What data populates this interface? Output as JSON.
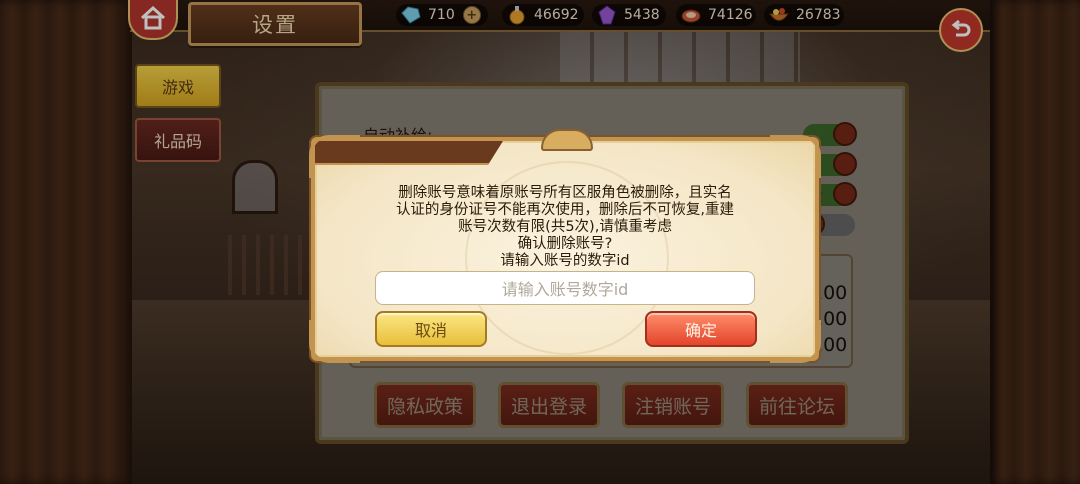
{
  "header": {
    "title": "设置",
    "resources": [
      {
        "icon": "crystal-icon",
        "value": "710",
        "has_plus": true
      },
      {
        "icon": "potion-icon",
        "value": "46692",
        "has_plus": false
      },
      {
        "icon": "gem-icon",
        "value": "5438",
        "has_plus": false
      },
      {
        "icon": "meat-icon",
        "value": "74126",
        "has_plus": false
      },
      {
        "icon": "food-bowl-icon",
        "value": "26783",
        "has_plus": false
      }
    ]
  },
  "tabs": {
    "game": "游戏",
    "gift_code": "礼品码"
  },
  "panel": {
    "auto_supply_label": "自动补给:",
    "numbers": [
      "100",
      "100",
      "100"
    ],
    "partial_text": "文",
    "buttons": {
      "privacy": "隐私政策",
      "logout": "退出登录",
      "delete_account": "注销账号",
      "forum": "前往论坛"
    }
  },
  "dialog": {
    "message_lines": [
      "删除账号意味着原账号所有区服角色被删除，且实名",
      "认证的身份证号不能再次使用，删除后不可恢复,重建",
      "账号次数有限(共5次),请慎重考虑",
      "确认删除账号?",
      "请输入账号的数字id"
    ],
    "input_placeholder": "请输入账号数字id",
    "cancel_label": "取消",
    "confirm_label": "确定"
  },
  "colors": {
    "accent_red": "#e3452c",
    "accent_yellow": "#e8bf3a",
    "frame_gold": "#c29450"
  }
}
